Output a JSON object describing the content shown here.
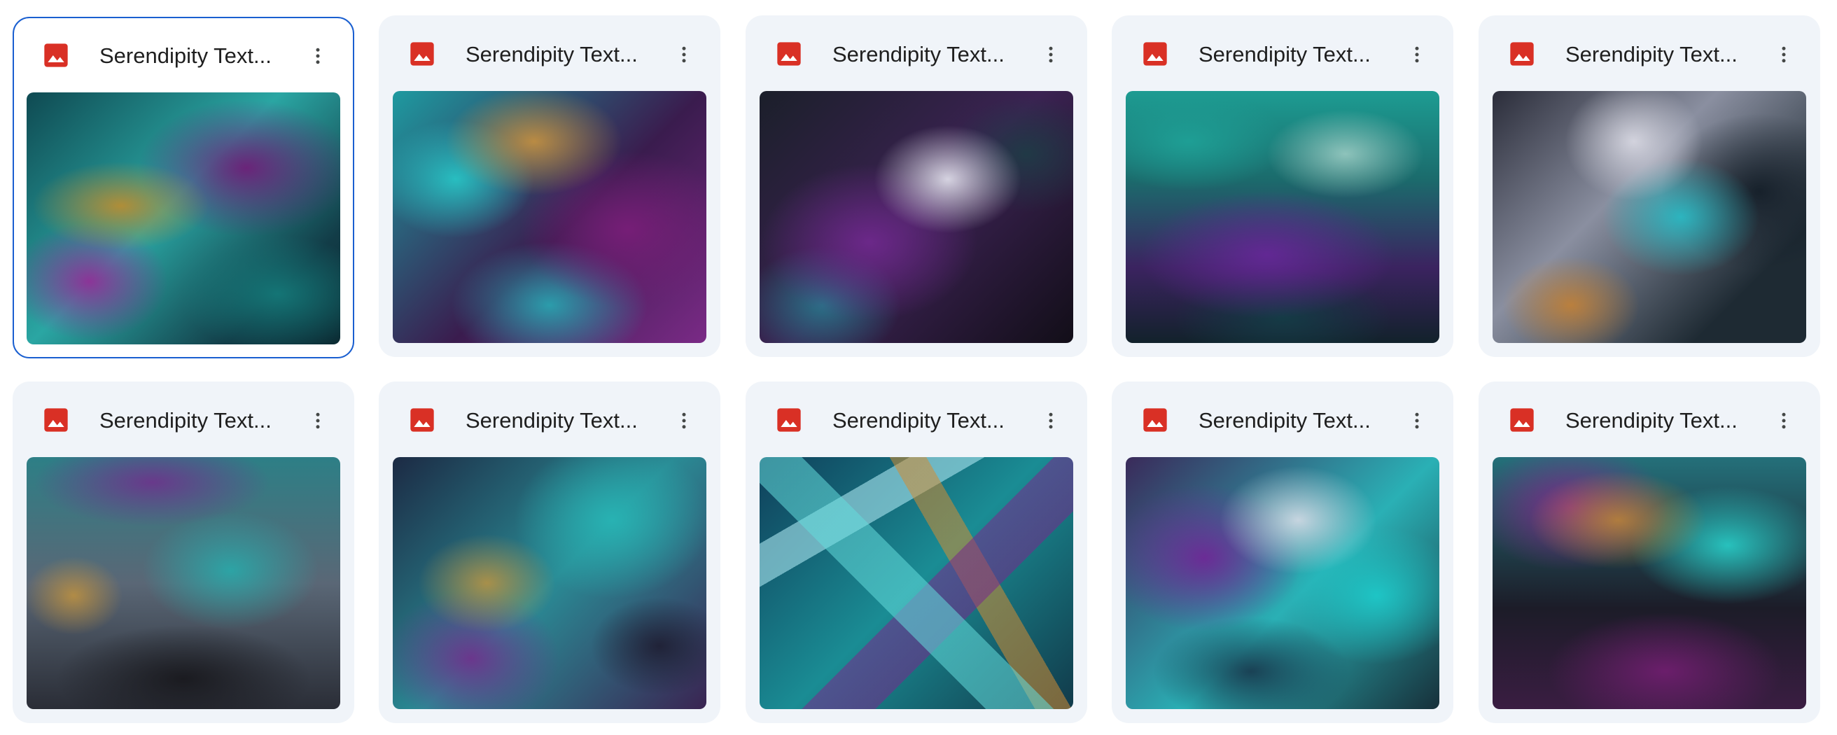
{
  "files": [
    {
      "title": "Serendipity Text...",
      "icon": "image-file-icon",
      "selected": true
    },
    {
      "title": "Serendipity Text...",
      "icon": "image-file-icon",
      "selected": false
    },
    {
      "title": "Serendipity Text...",
      "icon": "image-file-icon",
      "selected": false
    },
    {
      "title": "Serendipity Text...",
      "icon": "image-file-icon",
      "selected": false
    },
    {
      "title": "Serendipity Text...",
      "icon": "image-file-icon",
      "selected": false
    },
    {
      "title": "Serendipity Text...",
      "icon": "image-file-icon",
      "selected": false
    },
    {
      "title": "Serendipity Text...",
      "icon": "image-file-icon",
      "selected": false
    },
    {
      "title": "Serendipity Text...",
      "icon": "image-file-icon",
      "selected": false
    },
    {
      "title": "Serendipity Text...",
      "icon": "image-file-icon",
      "selected": false
    },
    {
      "title": "Serendipity Text...",
      "icon": "image-file-icon",
      "selected": false
    }
  ],
  "colors": {
    "image_icon_red": "#d93025",
    "card_background": "#f0f4f9",
    "selected_border": "#1a5fd0",
    "title_text": "#1f1f1f",
    "more_icon": "#444746"
  },
  "more_icon": "more-vert-icon"
}
